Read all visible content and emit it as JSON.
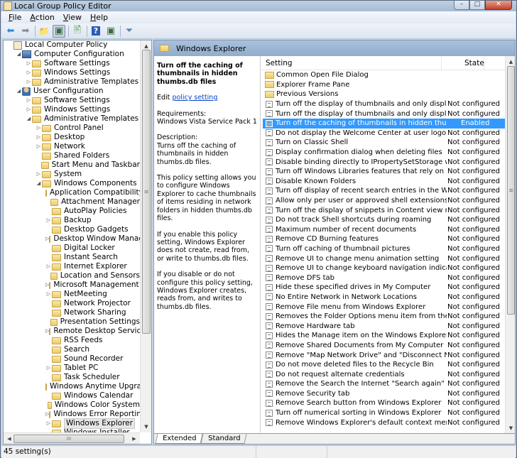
{
  "window": {
    "title": "Local Group Policy Editor",
    "minimize_glyph": "–",
    "maximize_glyph": "□",
    "close_glyph": "✕"
  },
  "menu": [
    "File",
    "Action",
    "View",
    "Help"
  ],
  "menu_accel": [
    "F",
    "A",
    "V",
    "H"
  ],
  "toolbar": [
    {
      "name": "back-icon",
      "glyph": "⬅",
      "color": "#2a8ad8"
    },
    {
      "name": "forward-icon",
      "glyph": "➡",
      "color": "#8a8a8a"
    },
    {
      "name": "up-folder-icon",
      "glyph": "📁",
      "color": "#d9a82a"
    },
    {
      "name": "show-hide-tree-icon",
      "glyph": "▣",
      "color": "#3a6a40"
    },
    {
      "name": "export-list-icon",
      "glyph": "🖹",
      "color": "#3a8a30"
    },
    {
      "name": "help-icon",
      "glyph": "?",
      "color": "#ffffff"
    },
    {
      "name": "action-pane-icon",
      "glyph": "▣",
      "color": "#3a6a40"
    },
    {
      "name": "filter-icon",
      "glyph": "⏷",
      "color": "#5a7fa8"
    }
  ],
  "tree": [
    {
      "label": "Local Computer Policy",
      "level": 0,
      "icon": "book",
      "arrow": ""
    },
    {
      "label": "Computer Configuration",
      "level": 1,
      "icon": "pc",
      "arrow": "◢"
    },
    {
      "label": "Software Settings",
      "level": 2,
      "icon": "folder",
      "arrow": "▷"
    },
    {
      "label": "Windows Settings",
      "level": 2,
      "icon": "folder",
      "arrow": "▷"
    },
    {
      "label": "Administrative Templates",
      "level": 2,
      "icon": "folder",
      "arrow": "▷"
    },
    {
      "label": "User Configuration",
      "level": 1,
      "icon": "user",
      "arrow": "◢"
    },
    {
      "label": "Software Settings",
      "level": 2,
      "icon": "folder",
      "arrow": "▷"
    },
    {
      "label": "Windows Settings",
      "level": 2,
      "icon": "folder",
      "arrow": "▷"
    },
    {
      "label": "Administrative Templates",
      "level": 2,
      "icon": "folder",
      "arrow": "◢"
    },
    {
      "label": "Control Panel",
      "level": 3,
      "icon": "folder",
      "arrow": "▷"
    },
    {
      "label": "Desktop",
      "level": 3,
      "icon": "folder",
      "arrow": "▷"
    },
    {
      "label": "Network",
      "level": 3,
      "icon": "folder",
      "arrow": "▷"
    },
    {
      "label": "Shared Folders",
      "level": 3,
      "icon": "folder",
      "arrow": ""
    },
    {
      "label": "Start Menu and Taskbar",
      "level": 3,
      "icon": "folder",
      "arrow": ""
    },
    {
      "label": "System",
      "level": 3,
      "icon": "folder",
      "arrow": "▷"
    },
    {
      "label": "Windows Components",
      "level": 3,
      "icon": "folder",
      "arrow": "◢"
    },
    {
      "label": "Application Compatibility",
      "level": 4,
      "icon": "folder",
      "arrow": ""
    },
    {
      "label": "Attachment Manager",
      "level": 4,
      "icon": "folder",
      "arrow": ""
    },
    {
      "label": "AutoPlay Policies",
      "level": 4,
      "icon": "folder",
      "arrow": ""
    },
    {
      "label": "Backup",
      "level": 4,
      "icon": "folder",
      "arrow": "▷"
    },
    {
      "label": "Desktop Gadgets",
      "level": 4,
      "icon": "folder",
      "arrow": ""
    },
    {
      "label": "Desktop Window Manager",
      "level": 4,
      "icon": "folder",
      "arrow": "▷"
    },
    {
      "label": "Digital Locker",
      "level": 4,
      "icon": "folder",
      "arrow": ""
    },
    {
      "label": "Instant Search",
      "level": 4,
      "icon": "folder",
      "arrow": ""
    },
    {
      "label": "Internet Explorer",
      "level": 4,
      "icon": "folder",
      "arrow": "▷"
    },
    {
      "label": "Location and Sensors",
      "level": 4,
      "icon": "folder",
      "arrow": ""
    },
    {
      "label": "Microsoft Management Console",
      "level": 4,
      "icon": "folder",
      "arrow": "▷"
    },
    {
      "label": "NetMeeting",
      "level": 4,
      "icon": "folder",
      "arrow": "▷"
    },
    {
      "label": "Network Projector",
      "level": 4,
      "icon": "folder",
      "arrow": ""
    },
    {
      "label": "Network Sharing",
      "level": 4,
      "icon": "folder",
      "arrow": ""
    },
    {
      "label": "Presentation Settings",
      "level": 4,
      "icon": "folder",
      "arrow": ""
    },
    {
      "label": "Remote Desktop Services",
      "level": 4,
      "icon": "folder",
      "arrow": "▷"
    },
    {
      "label": "RSS Feeds",
      "level": 4,
      "icon": "folder",
      "arrow": ""
    },
    {
      "label": "Search",
      "level": 4,
      "icon": "folder",
      "arrow": ""
    },
    {
      "label": "Sound Recorder",
      "level": 4,
      "icon": "folder",
      "arrow": ""
    },
    {
      "label": "Tablet PC",
      "level": 4,
      "icon": "folder",
      "arrow": "▷"
    },
    {
      "label": "Task Scheduler",
      "level": 4,
      "icon": "folder",
      "arrow": ""
    },
    {
      "label": "Windows Anytime Upgrade",
      "level": 4,
      "icon": "folder",
      "arrow": ""
    },
    {
      "label": "Windows Calendar",
      "level": 4,
      "icon": "folder",
      "arrow": ""
    },
    {
      "label": "Windows Color System",
      "level": 4,
      "icon": "folder",
      "arrow": ""
    },
    {
      "label": "Windows Error Reporting",
      "level": 4,
      "icon": "folder",
      "arrow": "▷"
    },
    {
      "label": "Windows Explorer",
      "level": 4,
      "icon": "folder",
      "arrow": "▷",
      "selected": true
    },
    {
      "label": "Windows Installer",
      "level": 4,
      "icon": "folder",
      "arrow": ""
    }
  ],
  "right_header": "Windows Explorer",
  "description": {
    "title": "Turn off the caching of thumbnails in hidden thumbs.db files",
    "edit_prefix": "Edit",
    "edit_link": "policy setting",
    "requirements_label": "Requirements:",
    "requirements_value": "Windows Vista Service Pack 1",
    "description_label": "Description:",
    "paragraphs": [
      "Turns off the caching of thumbnails in hidden thumbs.db files.",
      "This policy setting allows you to configure Windows Explorer to cache thumbnails of items residing in network folders in hidden thumbs.db files.",
      "If you enable this policy setting, Windows Explorer does not create, read from, or write to thumbs.db files.",
      "If you disable or do not configure this policy setting, Windows Explorer creates, reads from, and writes to thumbs.db files."
    ]
  },
  "list_columns": {
    "setting": "Setting",
    "state": "State"
  },
  "settings": [
    {
      "name": "Common Open File Dialog",
      "state": "",
      "type": "folder"
    },
    {
      "name": "Explorer Frame Pane",
      "state": "",
      "type": "folder"
    },
    {
      "name": "Previous Versions",
      "state": "",
      "type": "folder"
    },
    {
      "name": "Turn off the display of thumbnails and only display icons.",
      "state": "Not configured",
      "type": "policy"
    },
    {
      "name": "Turn off the display of thumbnails and only display icons on...",
      "state": "Not configured",
      "type": "policy"
    },
    {
      "name": "Turn off the caching of thumbnails in hidden thumbs.db files",
      "state": "Enabled",
      "type": "policy",
      "selected": true
    },
    {
      "name": "Do not display the Welcome Center at user logon",
      "state": "Not configured",
      "type": "policy"
    },
    {
      "name": "Turn on Classic Shell",
      "state": "Not configured",
      "type": "policy"
    },
    {
      "name": "Display confirmation dialog when deleting files",
      "state": "Not configured",
      "type": "policy"
    },
    {
      "name": "Disable binding directly to IPropertySetStorage without inter...",
      "state": "Not configured",
      "type": "policy"
    },
    {
      "name": "Turn off Windows Libraries features that rely on indexed file ...",
      "state": "Not configured",
      "type": "policy"
    },
    {
      "name": "Disable Known Folders",
      "state": "Not configured",
      "type": "policy"
    },
    {
      "name": "Turn off display of recent search entries in the Windows Expl...",
      "state": "Not configured",
      "type": "policy"
    },
    {
      "name": "Allow only per user or approved shell extensions",
      "state": "Not configured",
      "type": "policy"
    },
    {
      "name": "Turn off the display of snippets in Content view mode",
      "state": "Not configured",
      "type": "policy"
    },
    {
      "name": "Do not track Shell shortcuts during roaming",
      "state": "Not configured",
      "type": "policy"
    },
    {
      "name": "Maximum number of recent documents",
      "state": "Not configured",
      "type": "policy"
    },
    {
      "name": "Remove CD Burning features",
      "state": "Not configured",
      "type": "policy"
    },
    {
      "name": "Turn off caching of thumbnail pictures",
      "state": "Not configured",
      "type": "policy"
    },
    {
      "name": "Remove UI to change menu animation setting",
      "state": "Not configured",
      "type": "policy"
    },
    {
      "name": "Remove UI to change keyboard navigation indicator setting",
      "state": "Not configured",
      "type": "policy"
    },
    {
      "name": "Remove DFS tab",
      "state": "Not configured",
      "type": "policy"
    },
    {
      "name": "Hide these specified drives in My Computer",
      "state": "Not configured",
      "type": "policy"
    },
    {
      "name": "No Entire Network in Network Locations",
      "state": "Not configured",
      "type": "policy"
    },
    {
      "name": "Remove File menu from Windows Explorer",
      "state": "Not configured",
      "type": "policy"
    },
    {
      "name": "Removes the Folder Options menu item from the Tools menu",
      "state": "Not configured",
      "type": "policy"
    },
    {
      "name": "Remove Hardware tab",
      "state": "Not configured",
      "type": "policy"
    },
    {
      "name": "Hides the Manage item on the Windows Explorer context m...",
      "state": "Not configured",
      "type": "policy"
    },
    {
      "name": "Remove Shared Documents from My Computer",
      "state": "Not configured",
      "type": "policy"
    },
    {
      "name": "Remove \"Map Network Drive\" and \"Disconnect Network Dri...",
      "state": "Not configured",
      "type": "policy"
    },
    {
      "name": "Do not move deleted files to the Recycle Bin",
      "state": "Not configured",
      "type": "policy"
    },
    {
      "name": "Do not request alternate credentials",
      "state": "Not configured",
      "type": "policy"
    },
    {
      "name": "Remove the Search the Internet \"Search again\" link",
      "state": "Not configured",
      "type": "policy"
    },
    {
      "name": "Remove Security tab",
      "state": "Not configured",
      "type": "policy"
    },
    {
      "name": "Remove Search button from Windows Explorer",
      "state": "Not configured",
      "type": "policy"
    },
    {
      "name": "Turn off numerical sorting in Windows Explorer",
      "state": "Not configured",
      "type": "policy"
    },
    {
      "name": "Remove Windows Explorer's default context menu",
      "state": "Not configured",
      "type": "policy"
    }
  ],
  "tabs": [
    {
      "label": "Extended",
      "active": true
    },
    {
      "label": "Standard",
      "active": false
    }
  ],
  "status_text": "45 setting(s)",
  "scroll_glyphs": {
    "up": "▲",
    "down": "▼",
    "left": "◀",
    "right": "▶",
    "vgrip": "≡",
    "hgrip": "III"
  },
  "colors": {
    "selection": "#3399ff",
    "link": "#0645c8",
    "header": "#a9c1dd"
  }
}
